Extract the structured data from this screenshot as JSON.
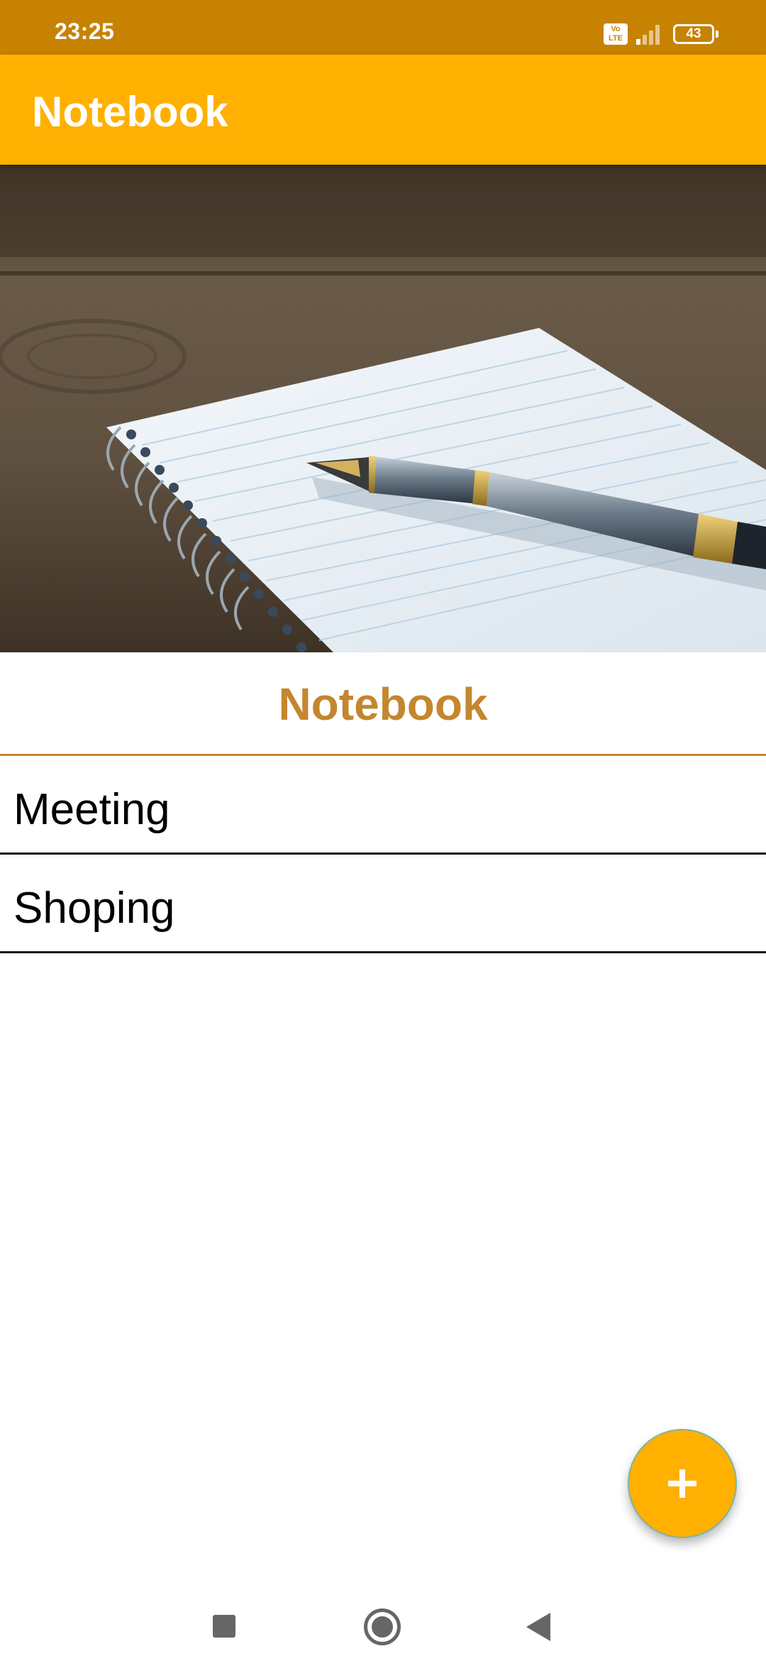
{
  "status_bar": {
    "time": "23:25",
    "network_badge": "Vo\nLTE",
    "battery_level": "43"
  },
  "app_bar": {
    "title": "Notebook"
  },
  "hero": {
    "description_icon": "notebook-with-pen-photo"
  },
  "section": {
    "title": "Notebook"
  },
  "notes": [
    {
      "label": "Meeting"
    },
    {
      "label": "Shoping"
    }
  ],
  "fab": {
    "icon": "plus-icon"
  },
  "nav": {
    "recents_icon": "square-icon",
    "home_icon": "circle-icon",
    "back_icon": "triangle-back-icon"
  },
  "colors": {
    "status_bar": "#c78202",
    "app_bar": "#ffb000",
    "accent_text": "#c4862e",
    "fab": "#ffb000"
  }
}
